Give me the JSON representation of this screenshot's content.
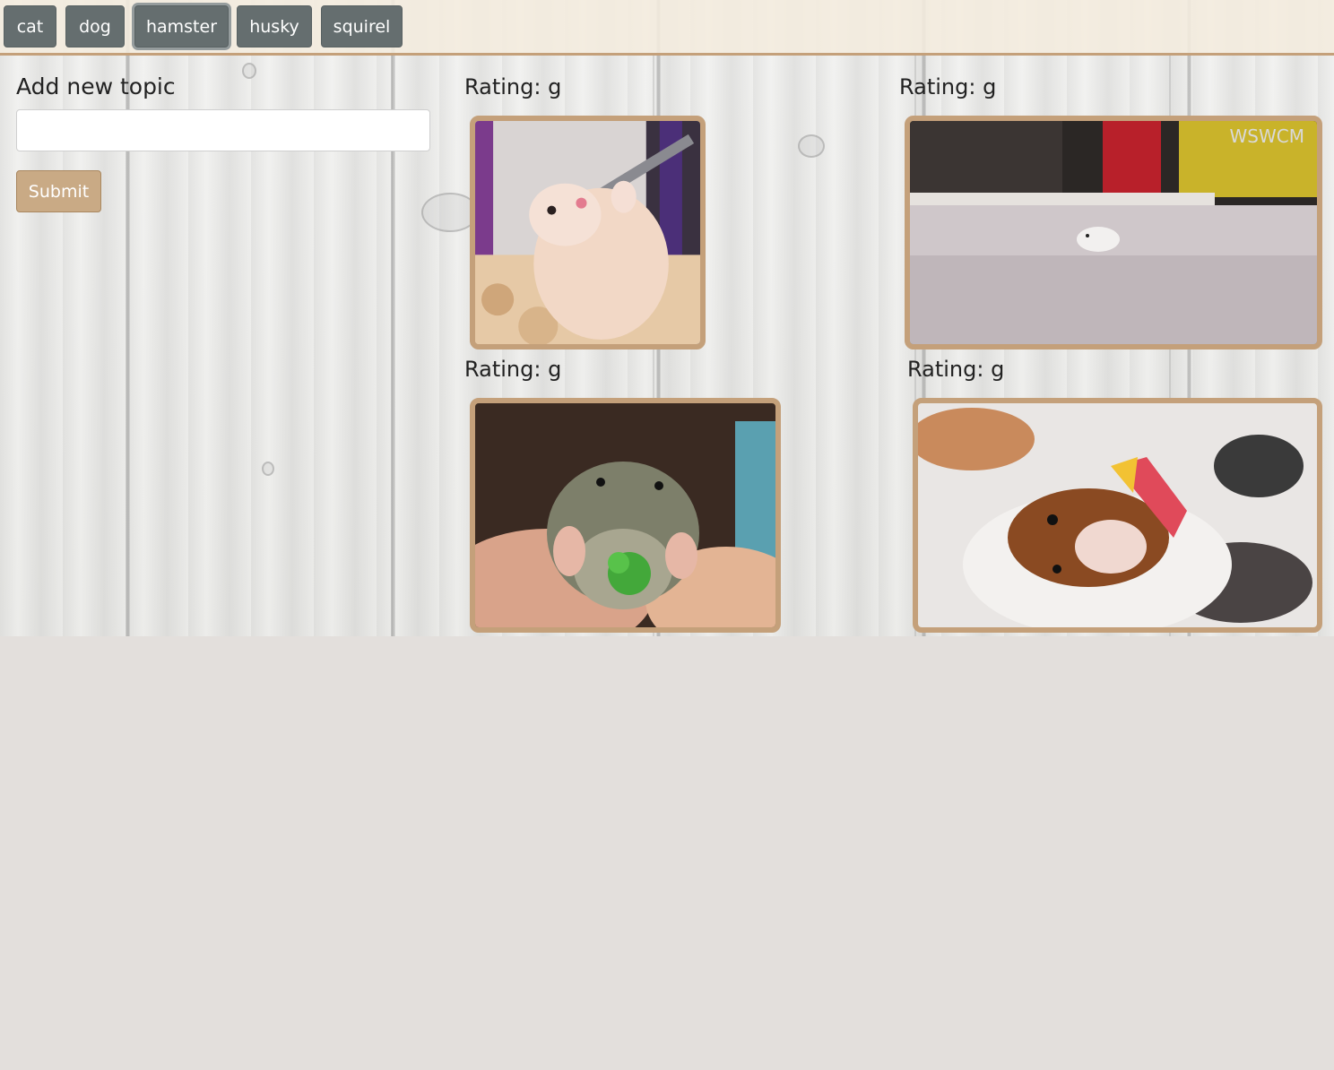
{
  "nav": {
    "topics": [
      "cat",
      "dog",
      "hamster",
      "husky",
      "squirel"
    ],
    "active_topic": "hamster"
  },
  "form": {
    "title": "Add new topic",
    "input_value": "",
    "submit_label": "Submit"
  },
  "gifs": [
    {
      "rating_label": "Rating: g",
      "alt": "hamster drinking from water bottle"
    },
    {
      "rating_label": "Rating: g",
      "alt": "hamster running on table",
      "watermark": "WSWCM"
    },
    {
      "rating_label": "Rating: g",
      "alt": "hamster eating broccoli"
    },
    {
      "rating_label": "Rating: g",
      "alt": "hamster in blanket holding candy"
    }
  ],
  "colors": {
    "topic_button": "#656e6f",
    "submit_button": "#c9aa85",
    "frame_border": "#c4a07a",
    "page_background": "#e3dfdc"
  }
}
